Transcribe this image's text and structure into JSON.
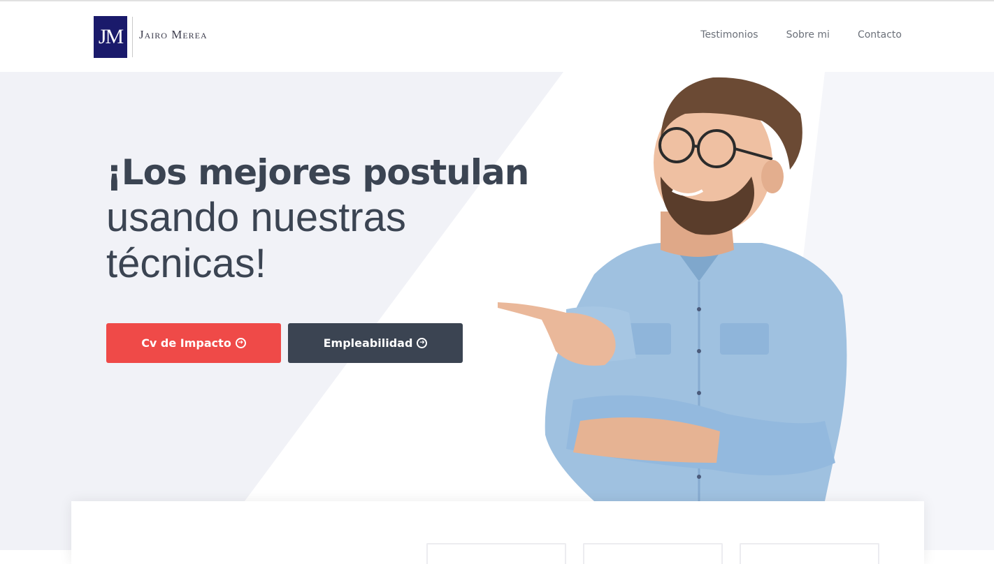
{
  "brand": {
    "monogram": "JM",
    "name": "Jairo Merea",
    "logo_color": "#1a1a6b"
  },
  "nav": {
    "items": [
      {
        "label": "Testimonios"
      },
      {
        "label": "Sobre mi"
      },
      {
        "label": "Contacto"
      }
    ]
  },
  "hero": {
    "title_bold": "¡Los mejores postulan",
    "title_line2": "usando nuestras",
    "title_line3": "técnicas!",
    "buttons": [
      {
        "label": "Cv de Impacto",
        "icon": "arrow-circle-right-icon",
        "color": "#ef4a48"
      },
      {
        "label": "Empleabilidad",
        "icon": "arrow-circle-right-icon",
        "color": "#3b4452"
      }
    ]
  },
  "colors": {
    "text_dark": "#3b4452",
    "hero_bg": "#f1f2f7",
    "accent_red": "#ef4a48",
    "nav_text": "#6b7079"
  }
}
